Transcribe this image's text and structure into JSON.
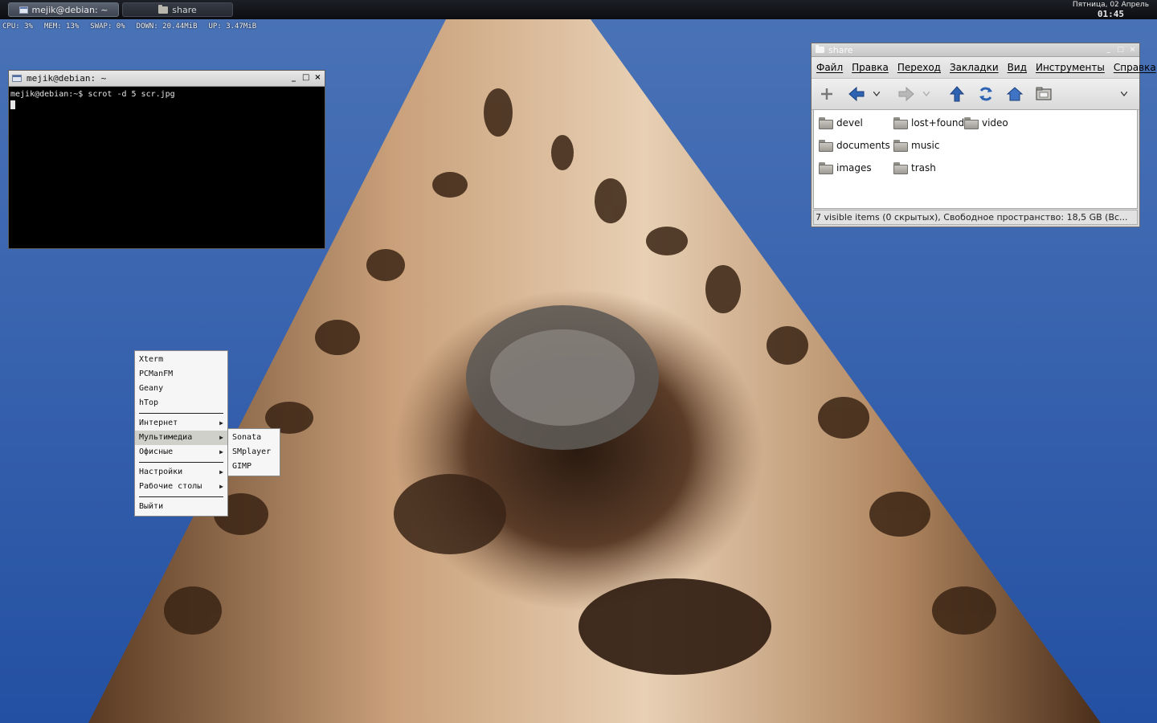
{
  "panel": {
    "tasks": [
      {
        "label": "mejik@debian: ~",
        "active": true,
        "icon": "terminal-icon"
      },
      {
        "label": "share",
        "active": false,
        "icon": "folder-icon"
      }
    ],
    "clock": {
      "date": "Пятница, 02 Апрель",
      "time": "01:45"
    }
  },
  "conky": {
    "cpu": "CPU: 3%",
    "mem": "MEM: 13%",
    "swap": "SWAP: 0%",
    "down": "DOWN: 20.44MiB",
    "up": "UP: 3.47MiB"
  },
  "terminal": {
    "title": "mejik@debian: ~",
    "line1": "mejik@debian:~$ scrot -d 5 scr.jpg",
    "buttons": [
      "_",
      "□",
      "×"
    ]
  },
  "filemanager": {
    "title": "share",
    "menu": [
      "Файл",
      "Правка",
      "Переход",
      "Закладки",
      "Вид",
      "Инструменты",
      "Справка"
    ],
    "toolbar": [
      "new-tab-icon",
      "back-icon",
      "forward-icon",
      "up-icon",
      "reload-icon",
      "home-icon",
      "folder-view-icon"
    ],
    "files": [
      "devel",
      "documents",
      "images",
      "lost+found",
      "music",
      "trash",
      "video"
    ],
    "status": "7 visible items (0 скрытых), Свободное пространство: 18,5 GB (Вс..."
  },
  "menu": {
    "items": [
      "Xterm",
      "PCManFM",
      "Geany",
      "hTop"
    ],
    "submenus": [
      "Интернет",
      "Мультимедиа",
      "Офисные",
      "Настройки",
      "Рабочие столы"
    ],
    "exit": "Выйти",
    "multimedia": [
      "Sonata",
      "SMplayer",
      "GIMP"
    ]
  },
  "colors": {
    "sky": "#2e5fb0",
    "panel": "#0c0d11",
    "highlight": "#cfd0c9"
  }
}
